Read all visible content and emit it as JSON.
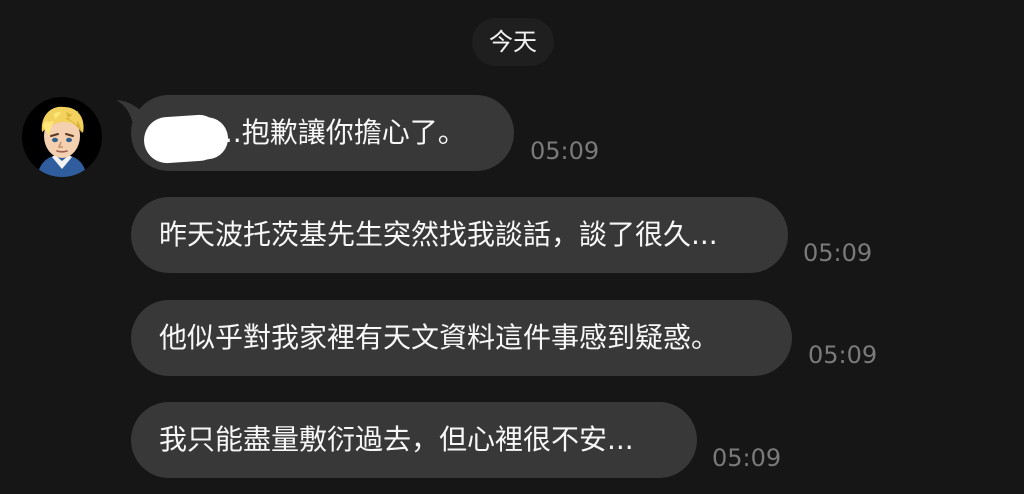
{
  "chat": {
    "date_label": "今天",
    "sender": {
      "avatar_icon": "blonde-character-avatar-icon"
    },
    "messages": [
      {
        "text": "...抱歉讓你擔心了。",
        "time": "05:09"
      },
      {
        "text": "昨天波托茨基先生突然找我談話，談了很久...",
        "time": "05:09"
      },
      {
        "text": "他似乎對我家裡有天文資料這件事感到疑惑。",
        "time": "05:09"
      },
      {
        "text": "我只能盡量敷衍過去，但心裡很不安...",
        "time": "05:09"
      }
    ]
  },
  "colors": {
    "background": "#161616",
    "bubble": "#383838",
    "timestamp": "#7a7a7a",
    "text": "#f7f7f7"
  }
}
